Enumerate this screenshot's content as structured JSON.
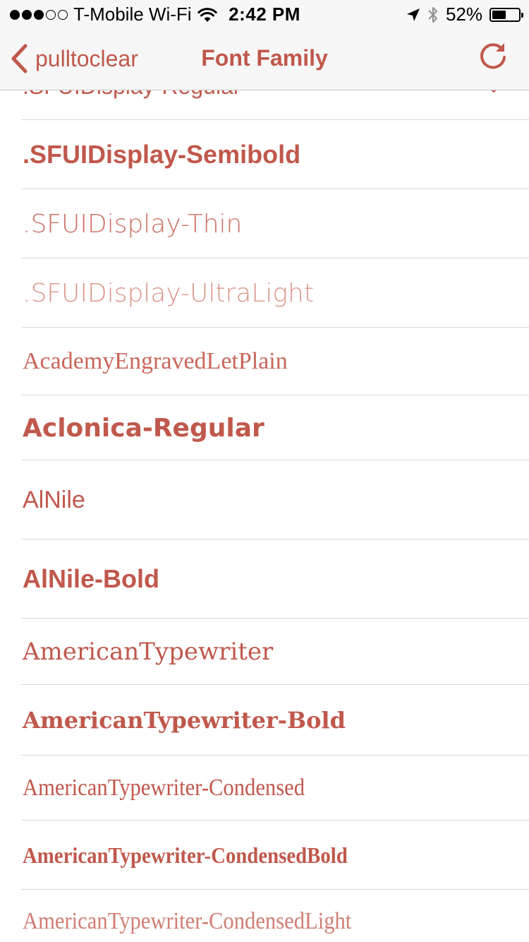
{
  "status_bar": {
    "carrier": "T-Mobile Wi-Fi",
    "time": "2:42 PM",
    "battery_percent": "52%",
    "battery_level": 0.52,
    "signal_bars_filled": 3,
    "signal_bars_total": 5,
    "icons": [
      "wifi-icon",
      "location-arrow-icon",
      "bluetooth-icon",
      "battery-icon"
    ]
  },
  "nav": {
    "back_label": "pulltoclear",
    "title": "Font Family",
    "refresh_icon": "refresh-icon"
  },
  "colors": {
    "accent": "#c0584c",
    "accent_light": "#d8877d",
    "bar_background": "#f7f7f7",
    "separator": "#d9d9d9"
  },
  "fonts": [
    {
      "name": ".SFUIDisplay-Regular",
      "selected": true
    },
    {
      "name": ".SFUIDisplay-Semibold",
      "selected": false
    },
    {
      "name": ".SFUIDisplay-Thin",
      "selected": false
    },
    {
      "name": ".SFUIDisplay-UltraLight",
      "selected": false
    },
    {
      "name": "AcademyEngravedLetPlain",
      "selected": false
    },
    {
      "name": "Aclonica-Regular",
      "selected": false
    },
    {
      "name": "AlNile",
      "selected": false
    },
    {
      "name": "AlNile-Bold",
      "selected": false
    },
    {
      "name": "AmericanTypewriter",
      "selected": false
    },
    {
      "name": "AmericanTypewriter-Bold",
      "selected": false
    },
    {
      "name": "AmericanTypewriter-Condensed",
      "selected": false
    },
    {
      "name": "AmericanTypewriter-CondensedBold",
      "selected": false
    },
    {
      "name": "AmericanTypewriter-CondensedLight",
      "selected": false
    }
  ]
}
